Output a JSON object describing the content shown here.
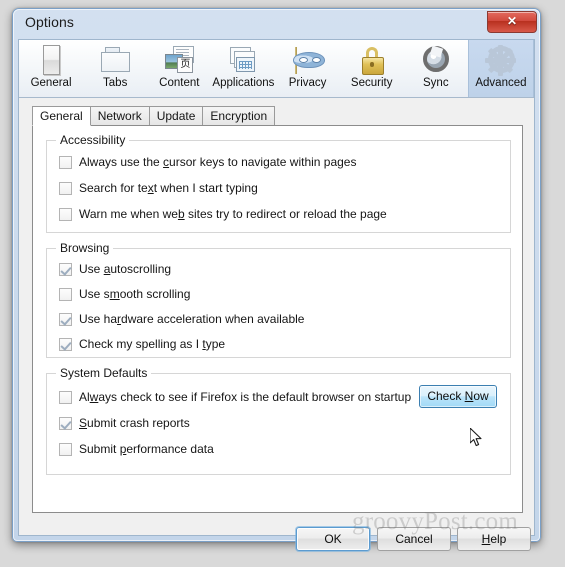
{
  "window": {
    "title": "Options",
    "close_label": "✕"
  },
  "categories": [
    {
      "label": "General",
      "icon": "general-window-icon",
      "selected": false
    },
    {
      "label": "Tabs",
      "icon": "tabs-folder-icon",
      "selected": false
    },
    {
      "label": "Content",
      "icon": "content-page-icon",
      "selected": false
    },
    {
      "label": "Applications",
      "icon": "applications-icon",
      "selected": false
    },
    {
      "label": "Privacy",
      "icon": "privacy-mask-icon",
      "selected": false
    },
    {
      "label": "Security",
      "icon": "security-padlock-icon",
      "selected": false
    },
    {
      "label": "Sync",
      "icon": "sync-arrows-icon",
      "selected": false
    },
    {
      "label": "Advanced",
      "icon": "advanced-gear-icon",
      "selected": true
    }
  ],
  "subtabs": [
    {
      "label": "General",
      "active": true
    },
    {
      "label": "Network",
      "active": false
    },
    {
      "label": "Update",
      "active": false
    },
    {
      "label": "Encryption",
      "active": false
    }
  ],
  "groups": [
    {
      "title": "Accessibility",
      "options": [
        {
          "pre": "Always use the ",
          "accel": "c",
          "post": "ursor keys to navigate within pages",
          "checked": false
        },
        {
          "pre": "Search for te",
          "accel": "x",
          "post": "t when I start typing",
          "checked": false
        },
        {
          "pre": "Warn me when we",
          "accel": "b",
          "post": " sites try to redirect or reload the page",
          "checked": false
        }
      ]
    },
    {
      "title": "Browsing",
      "options": [
        {
          "pre": "Use ",
          "accel": "a",
          "post": "utoscrolling",
          "checked": true
        },
        {
          "pre": "Use s",
          "accel": "m",
          "post": "ooth scrolling",
          "checked": false
        },
        {
          "pre": "Use ha",
          "accel": "r",
          "post": "dware acceleration when available",
          "checked": true
        },
        {
          "pre": "Check my spelling as I ",
          "accel": "t",
          "post": "ype",
          "checked": true
        }
      ]
    },
    {
      "title": "System Defaults",
      "options": [
        {
          "pre": "Al",
          "accel": "w",
          "post": "ays check to see if Firefox is the default browser on startup",
          "checked": false
        },
        {
          "pre": "",
          "accel": "S",
          "post": "ubmit crash reports",
          "checked": true
        },
        {
          "pre": "Submit ",
          "accel": "p",
          "post": "erformance data",
          "checked": false
        }
      ]
    }
  ],
  "check_now_button": {
    "pre": "Check ",
    "accel": "N",
    "post": "ow"
  },
  "dialog_buttons": [
    {
      "pre": "OK",
      "accel": "",
      "post": "",
      "default": true
    },
    {
      "pre": "Cancel",
      "accel": "",
      "post": "",
      "default": false
    },
    {
      "pre": "",
      "accel": "H",
      "post": "elp",
      "default": false
    }
  ],
  "watermark": "groovyPost.com",
  "colors": {
    "accent_selected_tab": "#c6d6ed",
    "frame_border": "#7a9fc6",
    "close_button_red": "#c8402f",
    "hover_button_blue": "#a1d9f6",
    "checkmark": "#9dadbf"
  }
}
